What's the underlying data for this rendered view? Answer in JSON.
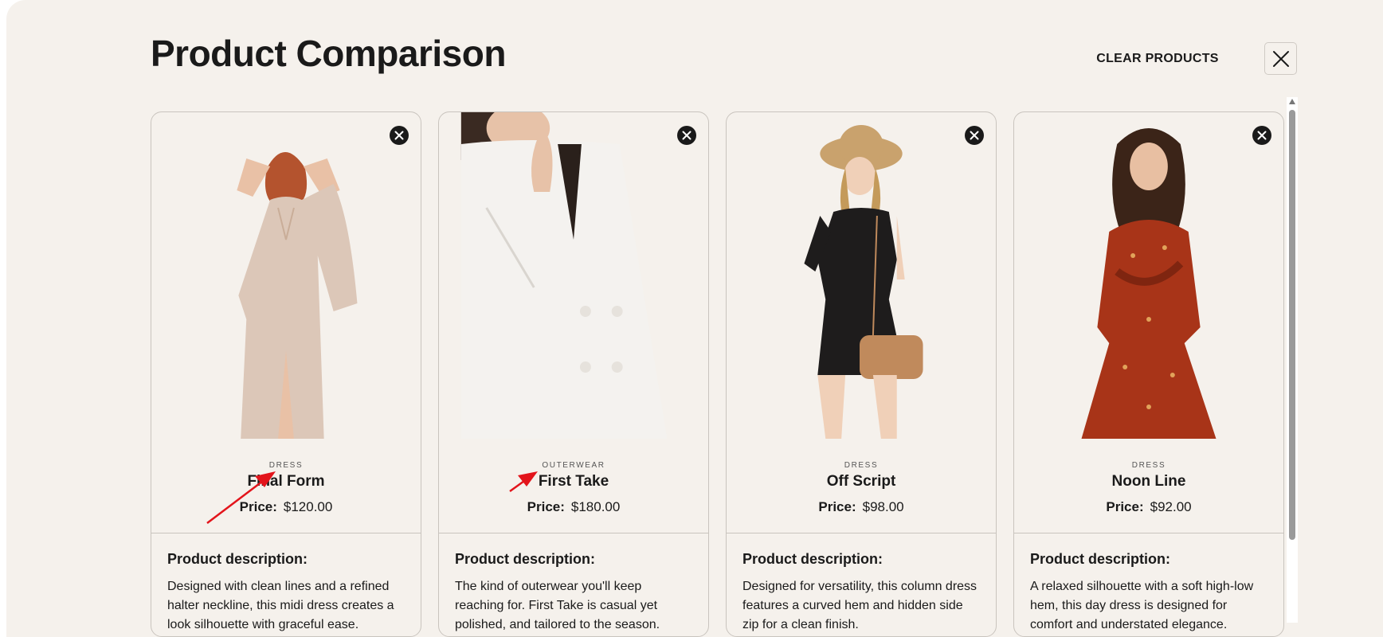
{
  "header": {
    "title": "Product Comparison",
    "clear_label": "CLEAR PRODUCTS",
    "close_icon": "close-icon"
  },
  "price_label": "Price:",
  "description_heading": "Product description:",
  "products": [
    {
      "category": "DRESS",
      "name": "Final Form",
      "price": "$120.00",
      "description": "Designed with clean lines and a refined halter neckline, this midi dress creates a look silhouette with graceful ease.",
      "image_desc": "woman in champagne sequin dress",
      "accent": "#d8c4b5"
    },
    {
      "category": "OUTERWEAR",
      "name": "First Take",
      "price": "$180.00",
      "description": "The kind of outerwear you'll keep reaching for. First Take is casual yet polished, and tailored to the season.",
      "image_desc": "woman in white double-breasted blazer",
      "accent": "#f3f1ee"
    },
    {
      "category": "DRESS",
      "name": "Off Script",
      "price": "$98.00",
      "description": "Designed for versatility, this column dress features a curved hem and hidden side zip for a clean finish.",
      "image_desc": "woman in black romper with tan bag and straw hat",
      "accent": "#1e1c1c"
    },
    {
      "category": "DRESS",
      "name": "Noon Line",
      "price": "$92.00",
      "description": "A relaxed silhouette with a soft high-low hem, this day dress is designed for comfort and understated elegance.",
      "image_desc": "woman in red floral long-sleeve dress",
      "accent": "#a83418"
    }
  ],
  "colors": {
    "background": "#f5f1ec",
    "border": "#c9c4be",
    "text": "#1a1a1a",
    "annotation_arrow": "#e3141b"
  }
}
